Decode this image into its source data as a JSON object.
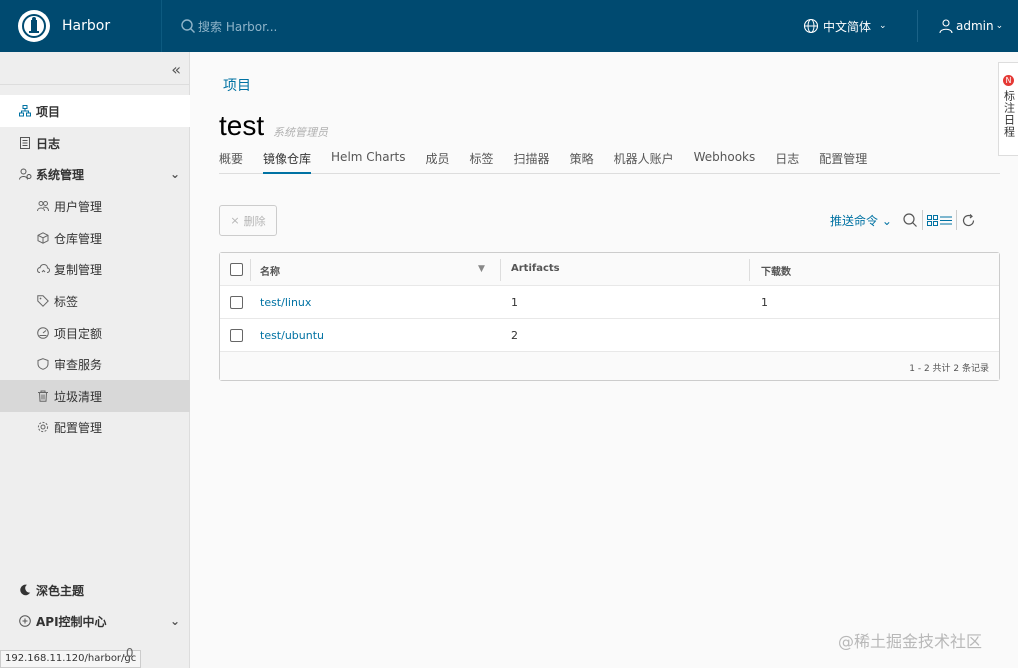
{
  "header": {
    "brand": "Harbor",
    "search_placeholder": "搜索 Harbor...",
    "language": "中文简体",
    "user": "admin"
  },
  "sidebar": {
    "collapse_glyph": "«",
    "items": [
      {
        "label": "项目",
        "icon": "project-icon"
      },
      {
        "label": "日志",
        "icon": "log-icon"
      },
      {
        "label": "系统管理",
        "icon": "admin-icon"
      },
      {
        "label": "用户管理",
        "icon": "users-icon"
      },
      {
        "label": "仓库管理",
        "icon": "registry-icon"
      },
      {
        "label": "复制管理",
        "icon": "replication-icon"
      },
      {
        "label": "标签",
        "icon": "tag-icon"
      },
      {
        "label": "项目定额",
        "icon": "quota-icon"
      },
      {
        "label": "审查服务",
        "icon": "interrogation-icon"
      },
      {
        "label": "垃圾清理",
        "icon": "trash-icon"
      },
      {
        "label": "配置管理",
        "icon": "config-icon"
      }
    ],
    "theme": "深色主题",
    "api_center": "API控制中心",
    "status_url": "192.168.11.120/harbor/gc",
    "status_tail": ".0"
  },
  "main": {
    "breadcrumb": "项目",
    "project_name": "test",
    "project_role": "系统管理员",
    "tabs": [
      "概要",
      "镜像仓库",
      "Helm Charts",
      "成员",
      "标签",
      "扫描器",
      "策略",
      "机器人账户",
      "Webhooks",
      "日志",
      "配置管理"
    ],
    "active_tab": "镜像仓库",
    "delete_label": "删除",
    "push_command": "推送命令",
    "table": {
      "columns": [
        "名称",
        "Artifacts",
        "下载数"
      ],
      "rows": [
        {
          "name": "test/linux",
          "artifacts": "1",
          "pulls": "1"
        },
        {
          "name": "test/ubuntu",
          "artifacts": "2",
          "pulls": ""
        }
      ],
      "pagination": "1 - 2 共计 2 条记录"
    }
  },
  "float_widget": {
    "badge": "N",
    "text": "标注日程"
  },
  "watermark": "@稀土掘金技术社区"
}
